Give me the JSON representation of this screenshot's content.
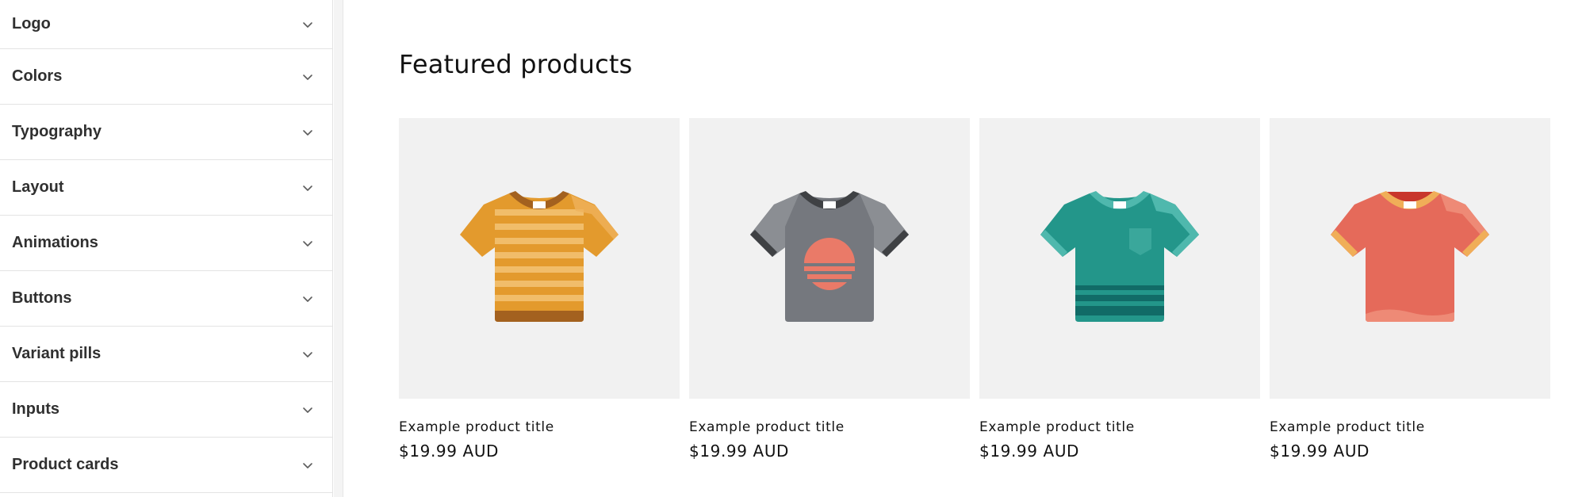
{
  "sidebar": {
    "items": [
      {
        "label": "Logo"
      },
      {
        "label": "Colors"
      },
      {
        "label": "Typography"
      },
      {
        "label": "Layout"
      },
      {
        "label": "Animations"
      },
      {
        "label": "Buttons"
      },
      {
        "label": "Variant pills"
      },
      {
        "label": "Inputs"
      },
      {
        "label": "Product cards"
      }
    ],
    "chevron_icon": "chevron-down-icon"
  },
  "preview": {
    "section_title": "Featured products",
    "products": [
      {
        "title": "Example product title",
        "price": "$19.99 AUD",
        "image_icon": "striped-tshirt-icon",
        "color": "#e39a2d"
      },
      {
        "title": "Example product title",
        "price": "$19.99 AUD",
        "image_icon": "sunset-tshirt-icon",
        "color": "#7a7d83"
      },
      {
        "title": "Example product title",
        "price": "$19.99 AUD",
        "image_icon": "pocket-tshirt-icon",
        "color": "#23968a"
      },
      {
        "title": "Example product title",
        "price": "$19.99 AUD",
        "image_icon": "plain-tshirt-icon",
        "color": "#e56a5a"
      }
    ]
  }
}
